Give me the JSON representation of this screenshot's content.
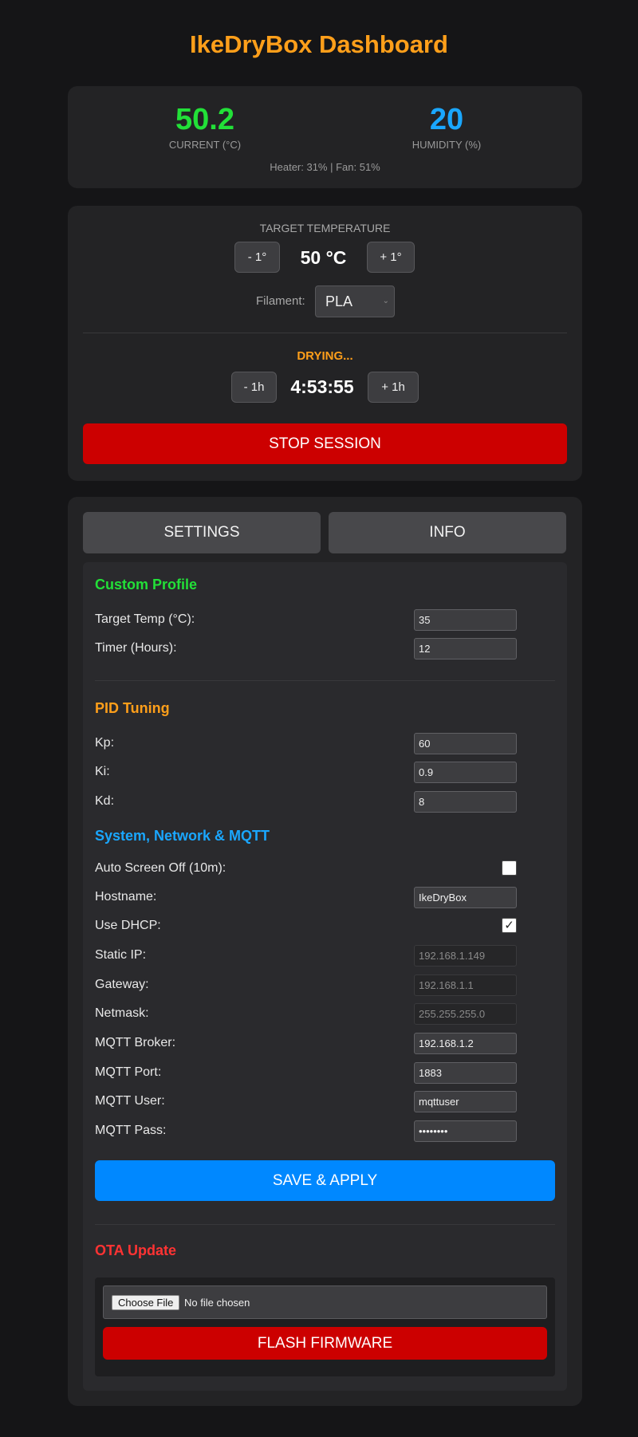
{
  "header": {
    "title": "IkeDryBox Dashboard"
  },
  "stats": {
    "current_temp": "50.2",
    "current_label": "CURRENT (°C)",
    "humidity": "20",
    "humidity_label": "HUMIDITY (%)",
    "heater_fan": "Heater: 31% | Fan: 51%"
  },
  "control": {
    "target_label": "TARGET TEMPERATURE",
    "temp_minus": "- 1°",
    "temp_value": "50 °C",
    "temp_plus": "+ 1°",
    "filament_label": "Filament:",
    "filament_selected": "PLA",
    "status": "DRYING...",
    "hour_minus": "- 1h",
    "time_left": "4:53:55",
    "hour_plus": "+ 1h",
    "stop_label": "STOP SESSION"
  },
  "tabs": {
    "settings": "SETTINGS",
    "info": "INFO"
  },
  "custom_profile": {
    "title": "Custom Profile",
    "target_temp_label": "Target Temp (°C):",
    "target_temp": "35",
    "timer_label": "Timer (Hours):",
    "timer": "12"
  },
  "pid": {
    "title": "PID Tuning",
    "kp_label": "Kp:",
    "kp": "60",
    "ki_label": "Ki:",
    "ki": "0.9",
    "kd_label": "Kd:",
    "kd": "8"
  },
  "system": {
    "title": "System, Network & MQTT",
    "screen_off_label": "Auto Screen Off (10m):",
    "screen_off": false,
    "hostname_label": "Hostname:",
    "hostname": "IkeDryBox",
    "dhcp_label": "Use DHCP:",
    "dhcp": true,
    "static_ip_label": "Static IP:",
    "static_ip": "192.168.1.149",
    "gateway_label": "Gateway:",
    "gateway": "192.168.1.1",
    "netmask_label": "Netmask:",
    "netmask": "255.255.255.0",
    "broker_label": "MQTT Broker:",
    "broker": "192.168.1.2",
    "port_label": "MQTT Port:",
    "port": "1883",
    "user_label": "MQTT User:",
    "user": "mqttuser",
    "pass_label": "MQTT Pass:",
    "pass": "••••••••",
    "save_label": "SAVE & APPLY"
  },
  "ota": {
    "title": "OTA Update",
    "choose_label": "Choose File",
    "no_file": "No file chosen",
    "flash_label": "FLASH FIRMWARE"
  },
  "colors": {
    "accent_orange": "#ff9f1a",
    "temp_green": "#22e038",
    "humidity_blue": "#1aa7ff",
    "danger_red": "#cc0000",
    "primary_blue": "#0088ff",
    "system_title_blue": "#1aa7ff",
    "ota_title_red": "#ff3333"
  }
}
